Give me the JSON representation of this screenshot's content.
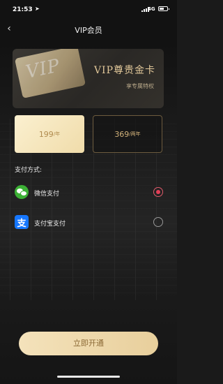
{
  "status_bar": {
    "time": "21:53",
    "location_icon": "location-arrow-icon",
    "network": "4G"
  },
  "nav": {
    "back_icon": "chevron-left-icon",
    "back_glyph": "‹",
    "title": "VIP会员"
  },
  "card": {
    "badge_text": "VIP",
    "title": "VIP尊贵金卡",
    "subtitle": "享专属特权"
  },
  "plans": [
    {
      "price": "199",
      "unit": "/年",
      "selected": true
    },
    {
      "price": "369",
      "unit": "/两年",
      "selected": false
    }
  ],
  "payment": {
    "label": "支付方式:",
    "methods": [
      {
        "name": "微信支付",
        "icon": "wechat-icon",
        "selected": true
      },
      {
        "name": "支付宝支付",
        "icon": "alipay-icon",
        "icon_glyph": "支",
        "selected": false
      }
    ]
  },
  "action": {
    "label": "立即开通"
  },
  "colors": {
    "gold_accent": "#e2c89a",
    "button_bg": "#f4e2bb",
    "radio_selected": "#e33e56",
    "wechat_green": "#3cb035",
    "alipay_blue": "#1677ff"
  }
}
